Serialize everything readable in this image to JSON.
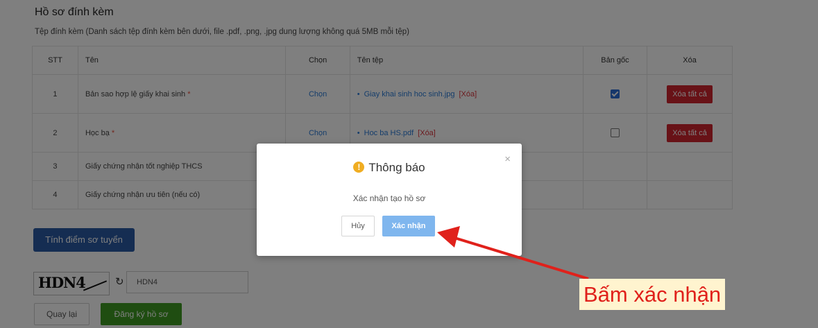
{
  "section": {
    "title": "Hồ sơ đính kèm",
    "note": "Tệp đính kèm (Danh sách tệp đính kèm bên dưới, file .pdf, .png, .jpg dung lượng không quá 5MB mỗi tệp)"
  },
  "table": {
    "headers": {
      "stt": "STT",
      "name": "Tên",
      "chon": "Chọn",
      "file": "Tên tệp",
      "orig": "Bản gốc",
      "del": "Xóa"
    },
    "rows": [
      {
        "stt": "1",
        "name": "Bản sao hợp lệ giấy khai sinh",
        "required": "*",
        "chon": "Chọn",
        "file": "Giay khai sinh hoc sinh.jpg",
        "file_remove": "[Xóa]",
        "orig_checked": true,
        "del": "Xóa tất cả"
      },
      {
        "stt": "2",
        "name": "Học bạ",
        "required": "*",
        "chon": "Chọn",
        "file": "Hoc ba HS.pdf",
        "file_remove": "[Xóa]",
        "orig_checked": false,
        "del": "Xóa tất cả"
      },
      {
        "stt": "3",
        "name": "Giấy chứng nhận tốt nghiệp THCS"
      },
      {
        "stt": "4",
        "name": "Giấy chứng nhận ưu tiên (nếu có)"
      }
    ]
  },
  "buttons": {
    "calc": "Tính điểm sơ tuyển",
    "back": "Quay lại",
    "submit": "Đăng ký hồ sơ"
  },
  "captcha": {
    "image_text": "HDN4",
    "value": "HDN4",
    "refresh_icon": "refresh-icon"
  },
  "modal": {
    "title": "Thông báo",
    "message": "Xác nhận tạo hồ sơ",
    "cancel": "Hủy",
    "confirm": "Xác nhận",
    "close": "×",
    "icon": "!"
  },
  "annotation": {
    "text": "Bấm xác nhận",
    "color": "#e0211b"
  }
}
